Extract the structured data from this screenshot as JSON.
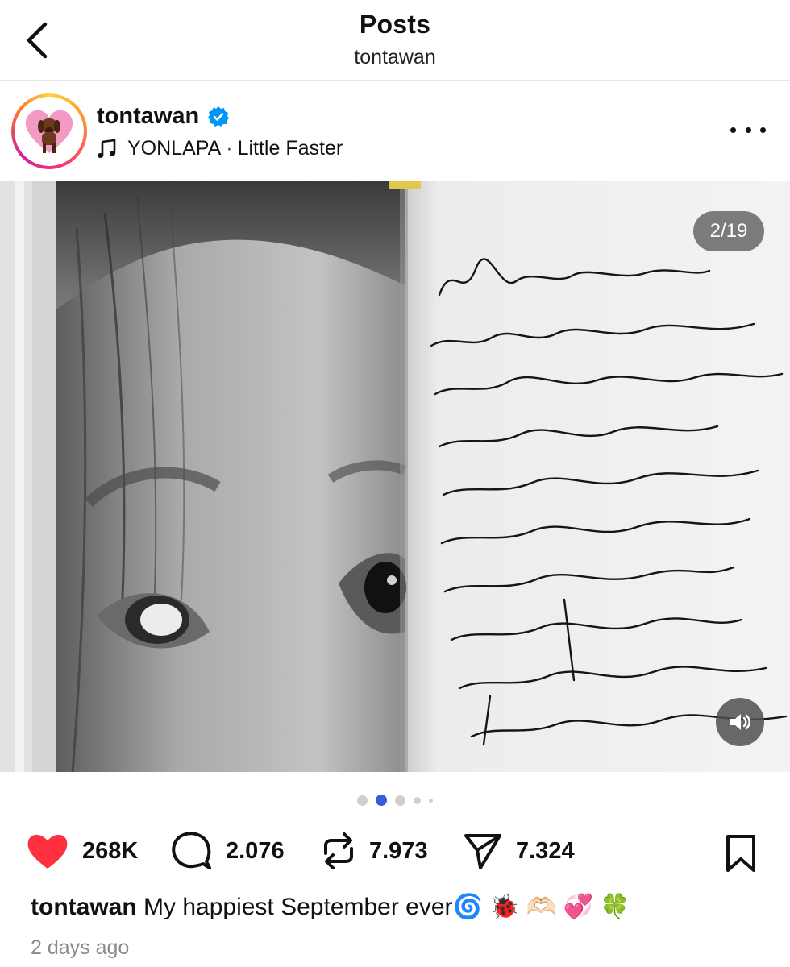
{
  "header": {
    "title": "Posts",
    "subtitle": "tontawan"
  },
  "post": {
    "username": "tontawan",
    "verified": true,
    "music_artist": "YONLAPA",
    "music_separator": "·",
    "music_song": "Little Faster",
    "page_indicator": "2/19",
    "carousel": {
      "current_index": 2,
      "visible_dots": 5
    },
    "handwritten_note": "Maybe some kinds of love aren't meant to be rushed, maybe they're meant to bloom quietly, in their own sweet time. And for now, I'll carry this summer-sparkling love quietly in my chest, like a secret gift that's still too precious to open",
    "stats": {
      "likes": "268K",
      "comments": "2.076",
      "reposts": "7.973",
      "shares": "7.324"
    },
    "caption_user": "tontawan",
    "caption_text": "My happiest September ever",
    "caption_emoji": "🌀 🐞 🫶🏻 💞 🍀",
    "time_ago": "2 days ago"
  },
  "icons": {
    "back": "chevron-left-icon",
    "verified": "verified-badge-icon",
    "music": "music-note-icon",
    "more": "more-horizontal-icon",
    "sound": "speaker-icon",
    "like": "heart-icon",
    "comment": "comment-bubble-icon",
    "repost": "repost-icon",
    "share": "send-icon",
    "bookmark": "bookmark-icon"
  },
  "colors": {
    "like_red": "#ff3040",
    "verified_blue": "#0095f6",
    "active_dot": "#3b5bdb",
    "muted_text": "#8a8a8a"
  }
}
